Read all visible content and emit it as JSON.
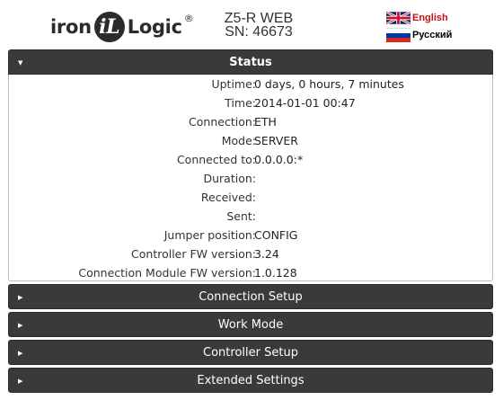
{
  "header": {
    "logo": {
      "left_text": "iron",
      "badge_text": "iL",
      "right_text": "Logic",
      "reg": "®"
    },
    "device_name": "Z5-R WEB",
    "serial": "SN: 46673",
    "languages": [
      {
        "label": "English",
        "flag": "uk-flag-icon",
        "color": "#cc1111"
      },
      {
        "label": "Русский",
        "flag": "ru-flag-icon",
        "color": "#000000"
      }
    ]
  },
  "status": {
    "title": "Status",
    "rows": [
      {
        "label": "Uptime:",
        "value": "0 days, 0 hours, 7 minutes"
      },
      {
        "label": "Time:",
        "value": "2014-01-01 00:47"
      },
      {
        "label": "Connection:",
        "value": "ETH"
      },
      {
        "label": "Mode:",
        "value": "SERVER"
      },
      {
        "label": "Connected to:",
        "value": "0.0.0.0:*"
      },
      {
        "label": "Duration:",
        "value": ""
      },
      {
        "label": "Received:",
        "value": ""
      },
      {
        "label": "Sent:",
        "value": ""
      },
      {
        "label": "Jumper position:",
        "value": "CONFIG"
      },
      {
        "label": "Controller FW version:",
        "value": "3.24"
      },
      {
        "label": "Connection Module FW version:",
        "value": "1.0.128"
      }
    ]
  },
  "sections": [
    {
      "label": "Connection Setup"
    },
    {
      "label": "Work Mode"
    },
    {
      "label": "Controller Setup"
    },
    {
      "label": "Extended Settings"
    }
  ],
  "colors": {
    "panel_header": "#3a3a3a",
    "panel_text": "#ffffff"
  }
}
